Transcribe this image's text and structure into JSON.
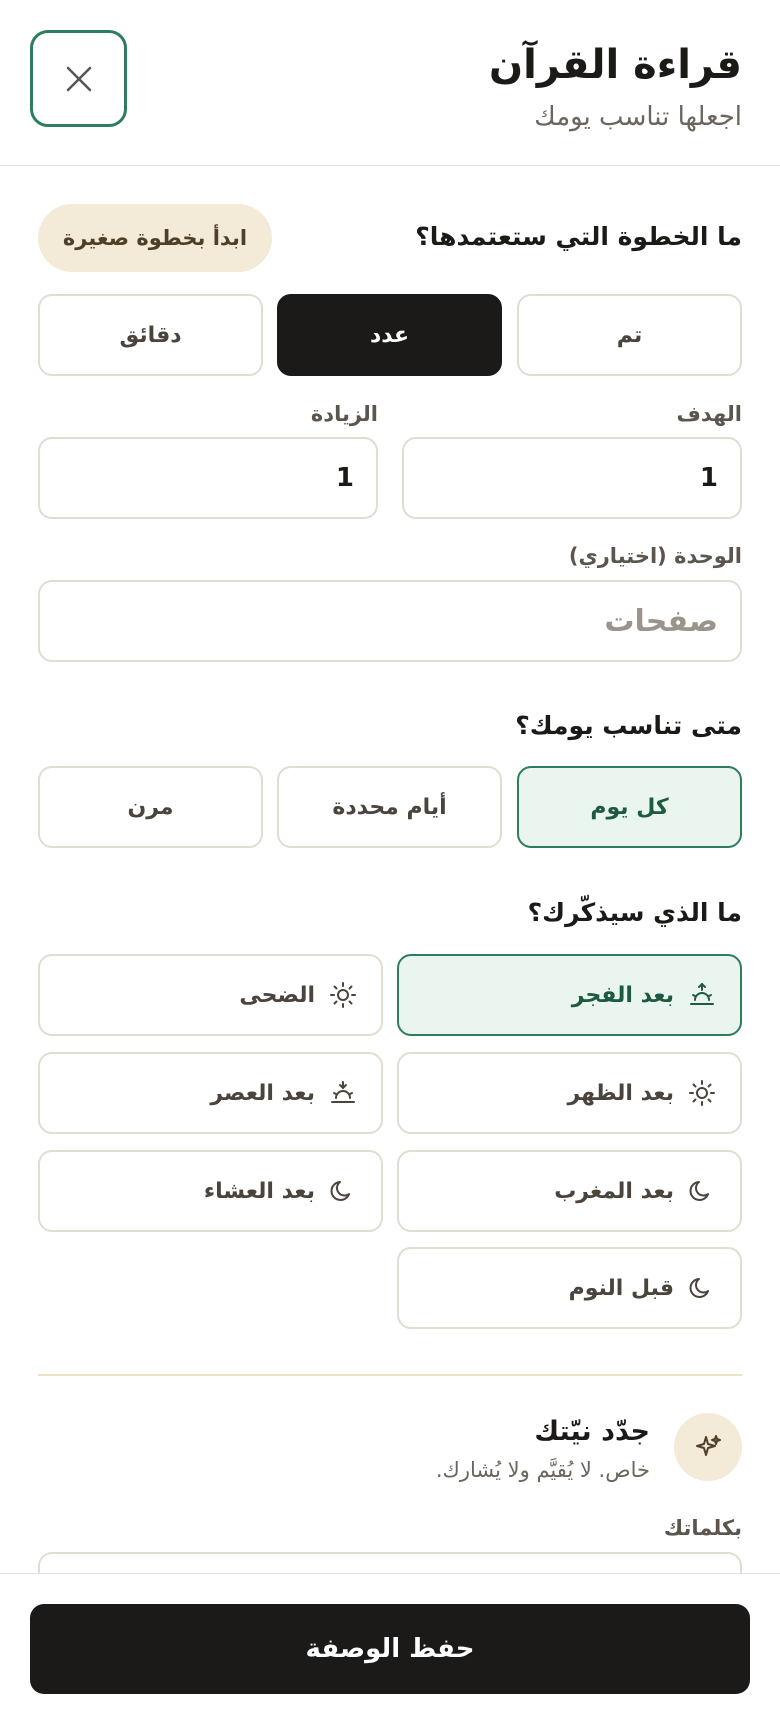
{
  "header": {
    "title": "قراءة القرآن",
    "subtitle": "اجعلها تناسب يومك",
    "close_icon": "close-icon"
  },
  "step": {
    "question": "ما الخطوة التي ستعتمدها؟",
    "chip": "ابدأ بخطوة صغيرة",
    "options": [
      "تم",
      "عدد",
      "دقائق"
    ],
    "selected": "عدد"
  },
  "fields": {
    "target_label": "الهدف",
    "target_value": "1",
    "increment_label": "الزيادة",
    "increment_value": "1",
    "unit_label": "الوحدة (اختياري)",
    "unit_placeholder": "صفحات"
  },
  "schedule": {
    "question": "متى تناسب يومك؟",
    "options": [
      "كل يوم",
      "أيام محددة",
      "مرن"
    ],
    "selected": "كل يوم"
  },
  "reminder": {
    "question": "ما الذي سيذكّرك؟",
    "options": [
      {
        "label": "بعد الفجر",
        "icon": "sunrise-icon"
      },
      {
        "label": "الضحى",
        "icon": "sun-icon"
      },
      {
        "label": "بعد الظهر",
        "icon": "sun-icon"
      },
      {
        "label": "بعد العصر",
        "icon": "sunset-icon"
      },
      {
        "label": "بعد المغرب",
        "icon": "moon-icon"
      },
      {
        "label": "بعد العشاء",
        "icon": "moon-icon"
      },
      {
        "label": "قبل النوم",
        "icon": "moon-icon"
      }
    ],
    "selected": "بعد الفجر"
  },
  "intention": {
    "title": "جدّد نيّتك",
    "subtitle": "خاص. لا يُقيَّم ولا يُشارك.",
    "icon": "sparkle-icon",
    "words_label": "بكلماتك"
  },
  "footer": {
    "save_label": "حفظ الوصفة"
  },
  "colors": {
    "accent_green": "#2e7d5e",
    "selected_bg": "#eaf5ef",
    "dark": "#1b1a18",
    "chip_bg": "#f3ead8"
  }
}
